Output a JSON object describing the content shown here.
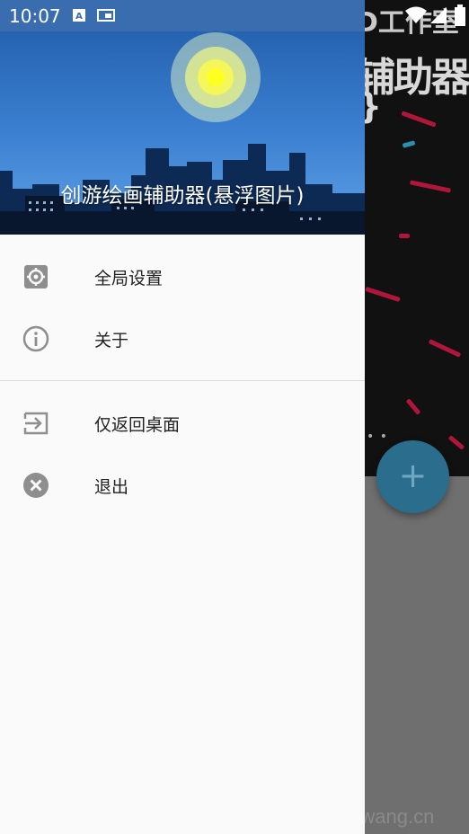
{
  "status_bar": {
    "time": "10:07"
  },
  "drawer": {
    "header_title": "创游绘画辅助器(悬浮图片)",
    "menu": [
      {
        "label": "全局设置",
        "icon": "gear-icon"
      },
      {
        "label": "关于",
        "icon": "info-icon"
      },
      {
        "label": "仅返回桌面",
        "icon": "exit-to-app-icon"
      },
      {
        "label": "退出",
        "icon": "cancel-circle-icon"
      }
    ]
  },
  "background_app": {
    "banner_line1": "D工作室",
    "banner_line2": "辅助器",
    "banner_line3": "}",
    "fab_symbol": "+",
    "dots": "• •"
  },
  "watermark": "youxiwang.cn",
  "colors": {
    "header_top": "#1f5aa6",
    "sun": "#ffff33",
    "fab": "#2a6d8d",
    "streak": "#b0163a"
  }
}
